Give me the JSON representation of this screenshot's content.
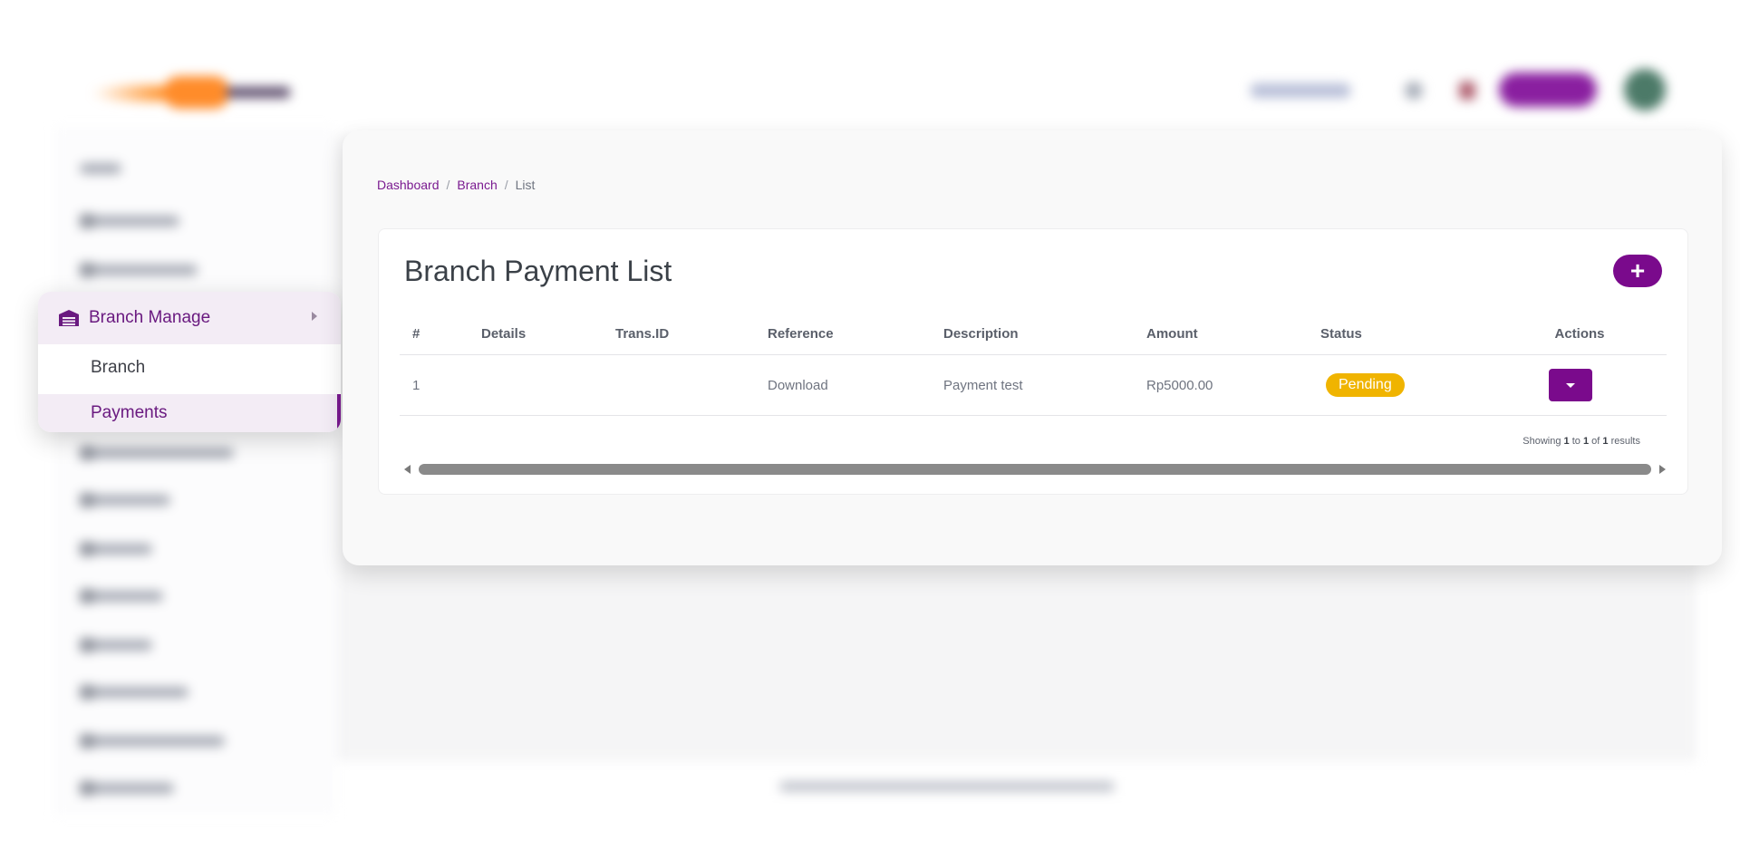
{
  "breadcrumb": {
    "items": [
      "Dashboard",
      "Branch",
      "List"
    ],
    "separator": "/"
  },
  "menu": {
    "group_label": "Branch Manage",
    "items": [
      {
        "label": "Branch"
      },
      {
        "label": "Payments"
      }
    ]
  },
  "page": {
    "title": "Branch Payment List",
    "add_icon": "+"
  },
  "table": {
    "columns": [
      "#",
      "Details",
      "Trans.ID",
      "Reference",
      "Description",
      "Amount",
      "Status",
      "Actions"
    ],
    "rows": [
      {
        "num": "1",
        "details": "",
        "trans_id": "",
        "reference": "Download",
        "description": "Payment test",
        "amount": "Rp5000.00",
        "status": "Pending"
      }
    ]
  },
  "pagination": {
    "prefix": "Showing",
    "from": "1",
    "to_word": "to",
    "to": "1",
    "of_word": "of",
    "total": "1",
    "suffix": "results"
  },
  "colors": {
    "accent": "#7a0a8c",
    "pending_badge": "#f0b400",
    "menu_highlight": "#f3ecf5"
  },
  "icons": {
    "menu_group": "warehouse-icon",
    "add": "plus-icon",
    "action": "caret-down-icon"
  }
}
